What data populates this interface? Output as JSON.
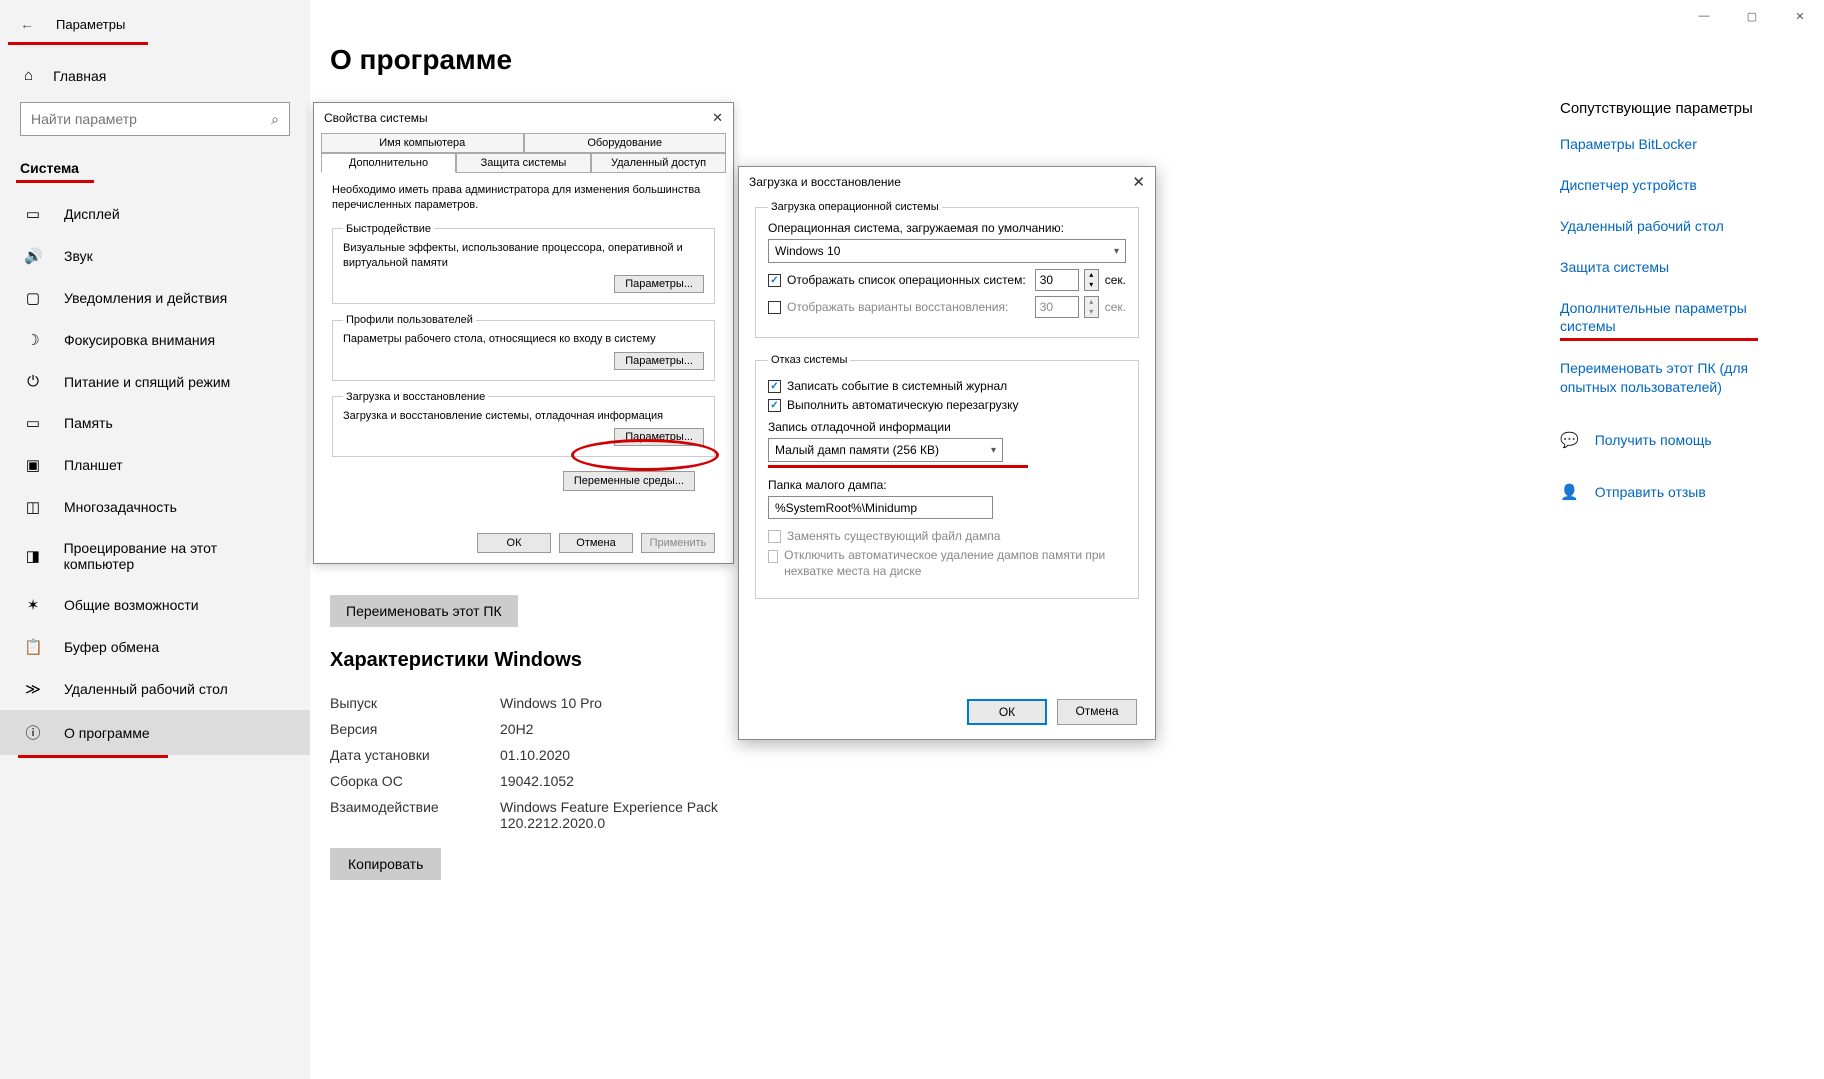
{
  "window_controls": {
    "minimize": "—",
    "maximize": "▢",
    "close": "✕"
  },
  "sidebar": {
    "back": "←",
    "title": "Параметры",
    "home": "Главная",
    "search_placeholder": "Найти параметр",
    "section": "Система",
    "items": [
      {
        "icon": "▭",
        "label": "Дисплей"
      },
      {
        "icon": "🔊",
        "label": "Звук"
      },
      {
        "icon": "▢",
        "label": "Уведомления и действия"
      },
      {
        "icon": "☽",
        "label": "Фокусировка внимания"
      },
      {
        "icon": "⏻",
        "label": "Питание и спящий режим"
      },
      {
        "icon": "▭",
        "label": "Память"
      },
      {
        "icon": "▣",
        "label": "Планшет"
      },
      {
        "icon": "◫",
        "label": "Многозадачность"
      },
      {
        "icon": "◨",
        "label": "Проецирование на этот компьютер"
      },
      {
        "icon": "✶",
        "label": "Общие возможности"
      },
      {
        "icon": "📋",
        "label": "Буфер обмена"
      },
      {
        "icon": "≫",
        "label": "Удаленный рабочий стол"
      },
      {
        "icon": "ⓘ",
        "label": "О программе"
      }
    ]
  },
  "main": {
    "title": "О программе",
    "rename_btn": "Переименовать этот ПК",
    "specs_title": "Характеристики Windows",
    "specs": [
      {
        "label": "Выпуск",
        "value": "Windows 10 Pro"
      },
      {
        "label": "Версия",
        "value": "20H2"
      },
      {
        "label": "Дата установки",
        "value": "01.10.2020"
      },
      {
        "label": "Сборка ОС",
        "value": "19042.1052"
      },
      {
        "label": "Взаимодействие",
        "value": "Windows Feature Experience Pack 120.2212.2020.0"
      }
    ],
    "copy_btn": "Копировать"
  },
  "dlg1": {
    "title": "Свойства системы",
    "close": "✕",
    "tabs_top": [
      "Имя компьютера",
      "Оборудование"
    ],
    "tabs_bottom": [
      "Дополнительно",
      "Защита системы",
      "Удаленный доступ"
    ],
    "note": "Необходимо иметь права администратора для изменения большинства перечисленных параметров.",
    "fs1_legend": "Быстродействие",
    "fs1_desc": "Визуальные эффекты, использование процессора, оперативной и виртуальной памяти",
    "btn_params": "Параметры...",
    "fs2_legend": "Профили пользователей",
    "fs2_desc": "Параметры рабочего стола, относящиеся ко входу в систему",
    "fs3_legend": "Загрузка и восстановление",
    "fs3_desc": "Загрузка и восстановление системы, отладочная информация",
    "env_vars": "Переменные среды...",
    "ok": "ОК",
    "cancel": "Отмена",
    "apply": "Применить"
  },
  "dlg2": {
    "title": "Загрузка и восстановление",
    "close": "✕",
    "fs1_legend": "Загрузка операционной системы",
    "os_label": "Операционная система, загружаемая по умолчанию:",
    "os_value": "Windows 10",
    "chk_list": "Отображать список операционных систем:",
    "list_seconds": "30",
    "chk_recovery": "Отображать варианты восстановления:",
    "recovery_seconds": "30",
    "sec": "сек.",
    "fs2_legend": "Отказ системы",
    "chk_log": "Записать событие в системный журнал",
    "chk_reboot": "Выполнить автоматическую перезагрузку",
    "debug_label": "Запись отладочной информации",
    "debug_value": "Малый дамп памяти (256 КВ)",
    "dump_label": "Папка малого дампа:",
    "dump_value": "%SystemRoot%\\Minidump",
    "chk_replace": "Заменять существующий файл дампа",
    "chk_disable_auto": "Отключить автоматическое удаление дампов памяти при нехватке места на диске",
    "ok": "ОК",
    "cancel": "Отмена"
  },
  "right": {
    "title": "Сопутствующие параметры",
    "links": [
      "Параметры BitLocker",
      "Диспетчер устройств",
      "Удаленный рабочий стол",
      "Защита системы",
      "Дополнительные параметры системы",
      "Переименовать этот ПК (для опытных пользователей)"
    ],
    "help": "Получить помощь",
    "feedback": "Отправить отзыв"
  }
}
